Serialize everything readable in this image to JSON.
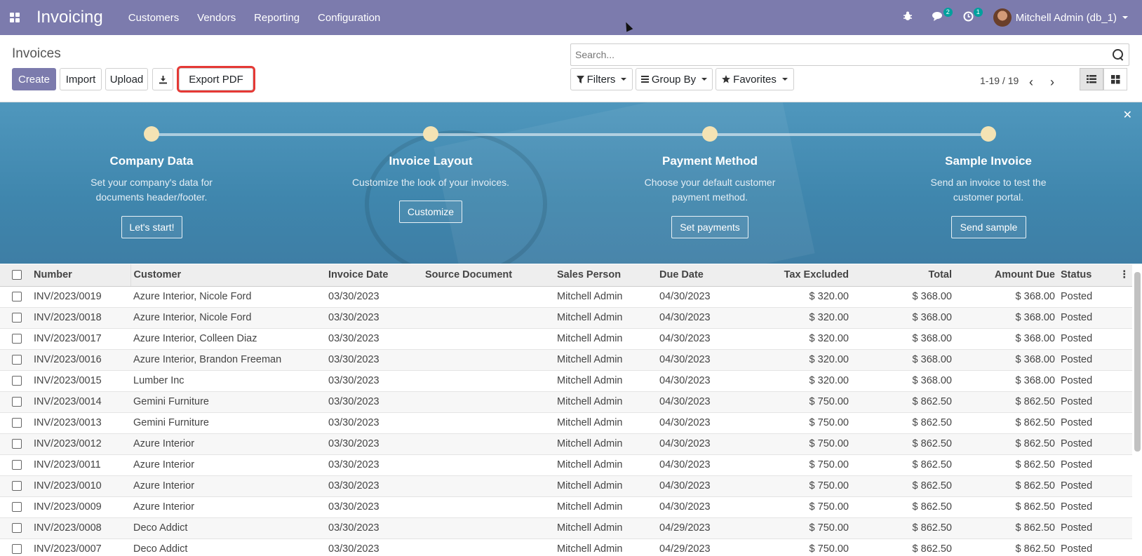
{
  "navbar": {
    "app_title": "Invoicing",
    "menu": [
      "Customers",
      "Vendors",
      "Reporting",
      "Configuration"
    ],
    "messages_count": "2",
    "activities_count": "1",
    "user_name": "Mitchell Admin (db_1)"
  },
  "control_panel": {
    "breadcrumb": "Invoices",
    "create_label": "Create",
    "import_label": "Import",
    "upload_label": "Upload",
    "export_pdf_label": "Export PDF",
    "search_placeholder": "Search...",
    "filters_label": "Filters",
    "group_by_label": "Group By",
    "favorites_label": "Favorites",
    "pager": "1-19 / 19"
  },
  "banner": {
    "steps": [
      {
        "title": "Company Data",
        "desc1": "Set your company's data for",
        "desc2": "documents header/footer.",
        "button": "Let's start!"
      },
      {
        "title": "Invoice Layout",
        "desc1": "Customize the look of your invoices.",
        "desc2": "",
        "button": "Customize"
      },
      {
        "title": "Payment Method",
        "desc1": "Choose your default customer",
        "desc2": "payment method.",
        "button": "Set payments"
      },
      {
        "title": "Sample Invoice",
        "desc1": "Send an invoice to test the",
        "desc2": "customer portal.",
        "button": "Send sample"
      }
    ],
    "accent_color": "#4f97bd"
  },
  "table": {
    "columns": [
      "Number",
      "Customer",
      "Invoice Date",
      "Source Document",
      "Sales Person",
      "Due Date",
      "Tax Excluded",
      "Total",
      "Amount Due",
      "Status"
    ],
    "rows": [
      [
        "INV/2023/0019",
        "Azure Interior, Nicole Ford",
        "03/30/2023",
        "",
        "Mitchell Admin",
        "04/30/2023",
        "$ 320.00",
        "$ 368.00",
        "$ 368.00",
        "Posted"
      ],
      [
        "INV/2023/0018",
        "Azure Interior, Nicole Ford",
        "03/30/2023",
        "",
        "Mitchell Admin",
        "04/30/2023",
        "$ 320.00",
        "$ 368.00",
        "$ 368.00",
        "Posted"
      ],
      [
        "INV/2023/0017",
        "Azure Interior, Colleen Diaz",
        "03/30/2023",
        "",
        "Mitchell Admin",
        "04/30/2023",
        "$ 320.00",
        "$ 368.00",
        "$ 368.00",
        "Posted"
      ],
      [
        "INV/2023/0016",
        "Azure Interior, Brandon Freeman",
        "03/30/2023",
        "",
        "Mitchell Admin",
        "04/30/2023",
        "$ 320.00",
        "$ 368.00",
        "$ 368.00",
        "Posted"
      ],
      [
        "INV/2023/0015",
        "Lumber Inc",
        "03/30/2023",
        "",
        "Mitchell Admin",
        "04/30/2023",
        "$ 320.00",
        "$ 368.00",
        "$ 368.00",
        "Posted"
      ],
      [
        "INV/2023/0014",
        "Gemini Furniture",
        "03/30/2023",
        "",
        "Mitchell Admin",
        "04/30/2023",
        "$ 750.00",
        "$ 862.50",
        "$ 862.50",
        "Posted"
      ],
      [
        "INV/2023/0013",
        "Gemini Furniture",
        "03/30/2023",
        "",
        "Mitchell Admin",
        "04/30/2023",
        "$ 750.00",
        "$ 862.50",
        "$ 862.50",
        "Posted"
      ],
      [
        "INV/2023/0012",
        "Azure Interior",
        "03/30/2023",
        "",
        "Mitchell Admin",
        "04/30/2023",
        "$ 750.00",
        "$ 862.50",
        "$ 862.50",
        "Posted"
      ],
      [
        "INV/2023/0011",
        "Azure Interior",
        "03/30/2023",
        "",
        "Mitchell Admin",
        "04/30/2023",
        "$ 750.00",
        "$ 862.50",
        "$ 862.50",
        "Posted"
      ],
      [
        "INV/2023/0010",
        "Azure Interior",
        "03/30/2023",
        "",
        "Mitchell Admin",
        "04/30/2023",
        "$ 750.00",
        "$ 862.50",
        "$ 862.50",
        "Posted"
      ],
      [
        "INV/2023/0009",
        "Azure Interior",
        "03/30/2023",
        "",
        "Mitchell Admin",
        "04/30/2023",
        "$ 750.00",
        "$ 862.50",
        "$ 862.50",
        "Posted"
      ],
      [
        "INV/2023/0008",
        "Deco Addict",
        "03/30/2023",
        "",
        "Mitchell Admin",
        "04/29/2023",
        "$ 750.00",
        "$ 862.50",
        "$ 862.50",
        "Posted"
      ],
      [
        "INV/2023/0007",
        "Deco Addict",
        "03/30/2023",
        "",
        "Mitchell Admin",
        "04/29/2023",
        "$ 750.00",
        "$ 862.50",
        "$ 862.50",
        "Posted"
      ]
    ]
  },
  "colors": {
    "navbar": "#7c7bad",
    "highlight_border": "#e53935"
  }
}
